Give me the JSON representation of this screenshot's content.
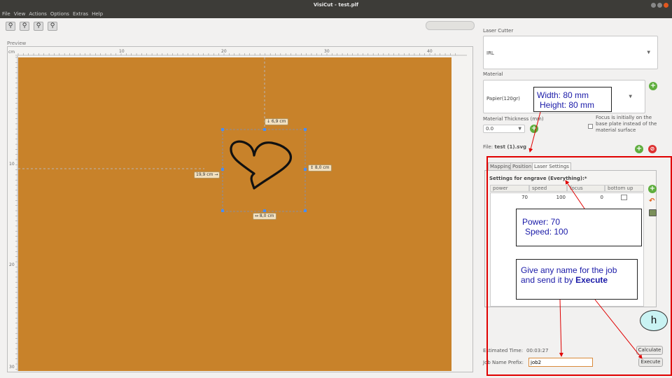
{
  "window": {
    "title": "VisiCut - test.plf"
  },
  "menu": [
    "File",
    "View",
    "Actions",
    "Options",
    "Extras",
    "Help"
  ],
  "toolbar": {
    "zoom_icons": [
      "zoom-fit-icon",
      "zoom-in-icon",
      "zoom-out-icon",
      "zoom-reset-icon"
    ]
  },
  "preview": {
    "label": "Preview",
    "unit": "cm",
    "ruler_top": [
      "10",
      "20",
      "30",
      "40"
    ],
    "ruler_left": [
      "10",
      "20",
      "30"
    ],
    "bed_color": "#c8822a",
    "dims": {
      "top": "↓ 6,9 cm",
      "left": "19,9 cm →",
      "right": "↕ 8,0 cm",
      "bottom": "↔ 8,0 cm"
    }
  },
  "panel": {
    "laser_cutter_label": "Laser Cutter",
    "laser_cutter_value": "IRL",
    "material_label": "Material",
    "material_value": "Papier(120gr)",
    "thickness_label": "Material Thickness (mm)",
    "thickness_value": "0.0",
    "focus_text": "Focus is initially on the base plate instead of the material surface",
    "file_label": "File:",
    "file_name": "test (1).svg",
    "tabs": [
      "Mapping",
      "Position",
      "Laser Settings"
    ],
    "settings_title": "Settings for engrave (Everything):*",
    "columns": [
      "power",
      "speed",
      "focus",
      "bottom up"
    ],
    "row": {
      "power": "70",
      "speed": "100",
      "focus": "0"
    },
    "estimated_label": "Estimated Time:",
    "estimated_value": "00:03:27",
    "calculate": "Calculate",
    "job_prefix_label": "Job Name Prefix:",
    "job_prefix_value": "job2",
    "execute": "Execute"
  },
  "annotations": {
    "size": [
      "Width: 80 mm",
      "Height: 80 mm"
    ],
    "power": [
      "Power: 70",
      "Speed: 100"
    ],
    "name_line1": "Give any name for the job",
    "name_line2_pre": "and send it by ",
    "name_line2_bold": "Execute",
    "badge": "h",
    "colors": {
      "highlight": "#e00000",
      "annotation_text": "#1a1aa8",
      "badge_fill": "#c9f3f3"
    }
  }
}
